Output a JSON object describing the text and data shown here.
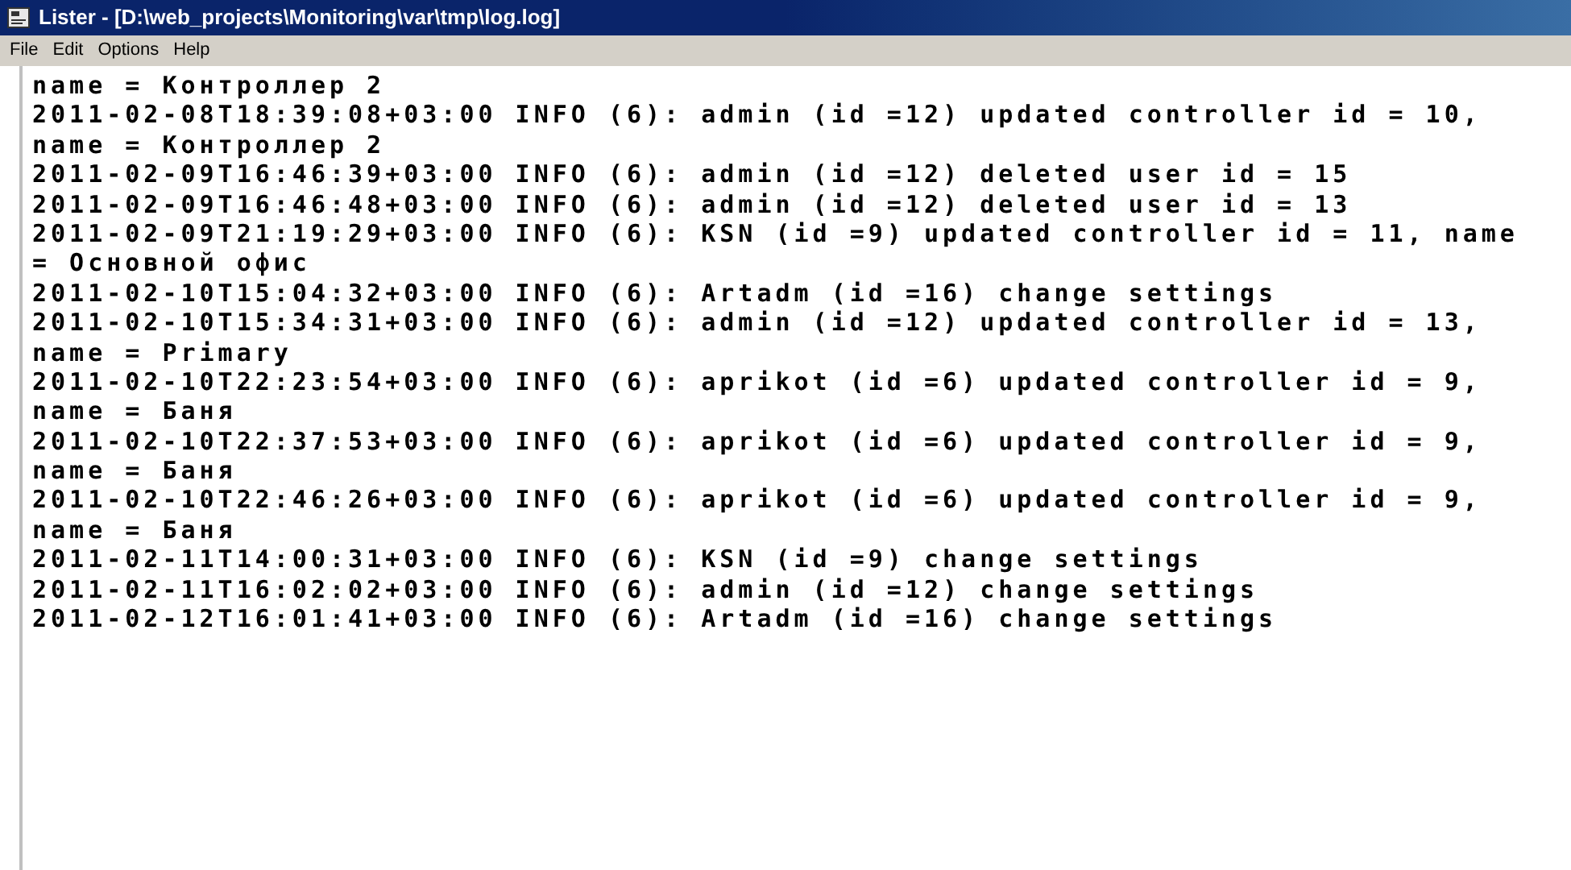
{
  "window": {
    "title": "Lister - [D:\\web_projects\\Monitoring\\var\\tmp\\log.log]"
  },
  "menu": [
    "File",
    "Edit",
    "Options",
    "Help"
  ],
  "lines": [
    "name = Контроллер 2",
    "2011-02-08T18:39:08+03:00 INFO (6): admin (id =12) updated controller id = 10,",
    "name = Контроллер 2",
    "2011-02-09T16:46:39+03:00 INFO (6): admin (id =12) deleted user id = 15",
    "2011-02-09T16:46:48+03:00 INFO (6): admin (id =12) deleted user id = 13",
    "2011-02-09T21:19:29+03:00 INFO (6): KSN (id =9) updated controller id = 11, name",
    "= Основной офис",
    "2011-02-10T15:04:32+03:00 INFO (6): Artadm (id =16) change settings",
    "2011-02-10T15:34:31+03:00 INFO (6): admin (id =12) updated controller id = 13,",
    "name = Primary",
    "2011-02-10T22:23:54+03:00 INFO (6): aprikot (id =6) updated controller id = 9,",
    "name = Баня",
    "2011-02-10T22:37:53+03:00 INFO (6): aprikot (id =6) updated controller id = 9,",
    "name = Баня",
    "2011-02-10T22:46:26+03:00 INFO (6): aprikot (id =6) updated controller id = 9,",
    "name = Баня",
    "2011-02-11T14:00:31+03:00 INFO (6): KSN (id =9) change settings",
    "2011-02-11T16:02:02+03:00 INFO (6): admin (id =12) change settings",
    "2011-02-12T16:01:41+03:00 INFO (6): Artadm (id =16) change settings"
  ]
}
